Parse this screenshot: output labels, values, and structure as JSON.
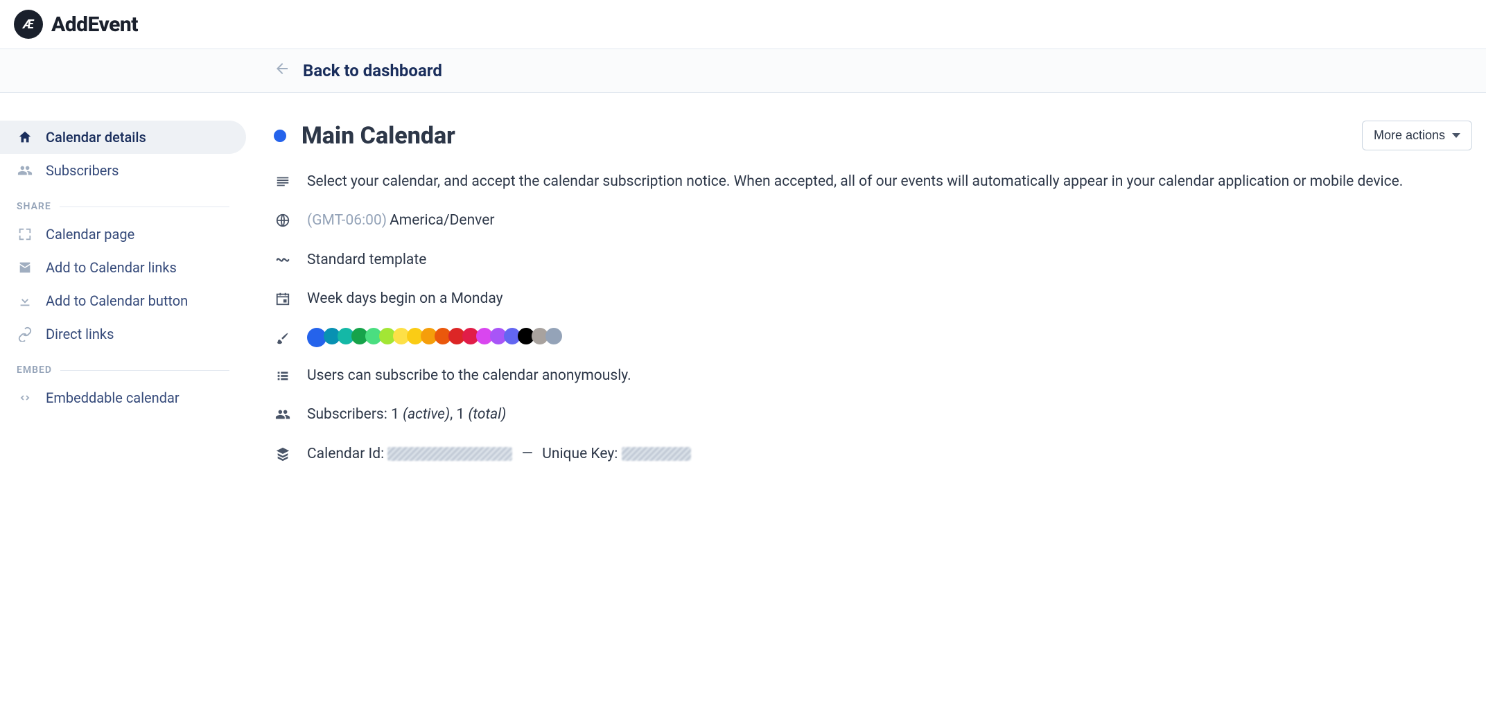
{
  "brand": "AddEvent",
  "logo_text": "Æ",
  "backbar": {
    "label": "Back to dashboard"
  },
  "sidebar": {
    "items": [
      {
        "label": "Calendar details"
      },
      {
        "label": "Subscribers"
      }
    ],
    "share_label": "SHARE",
    "share_items": [
      {
        "label": "Calendar page"
      },
      {
        "label": "Add to Calendar links"
      },
      {
        "label": "Add to Calendar button"
      },
      {
        "label": "Direct links"
      }
    ],
    "embed_label": "EMBED",
    "embed_items": [
      {
        "label": "Embeddable calendar"
      }
    ]
  },
  "main": {
    "title": "Main Calendar",
    "more_actions": "More actions",
    "accent_color": "#2563eb",
    "description": "Select your calendar, and accept the calendar subscription notice. When accepted, all of our events will automatically appear in your calendar application or mobile device.",
    "timezone_gmt": "(GMT-06:00)",
    "timezone_name": "America/Denver",
    "template": "Standard template",
    "week_start": "Week days begin on a Monday",
    "palette": [
      "#2563eb",
      "#0891b2",
      "#14b8a6",
      "#16a34a",
      "#4ade80",
      "#a3e635",
      "#fde047",
      "#facc15",
      "#f59e0b",
      "#ea580c",
      "#dc2626",
      "#e11d48",
      "#d946ef",
      "#a855f7",
      "#6366f1",
      "#000000",
      "#a8a29e",
      "#94a3b8"
    ],
    "anon_text": "Users can subscribe to the calendar anonymously.",
    "subscribers_label": "Subscribers:",
    "subscribers_active_n": "1",
    "subscribers_active_suffix": "(active)",
    "subscribers_total_n": "1",
    "subscribers_total_suffix": "(total)",
    "calendar_id_label": "Calendar Id:",
    "unique_key_label": "Unique Key:",
    "separator": "—"
  }
}
